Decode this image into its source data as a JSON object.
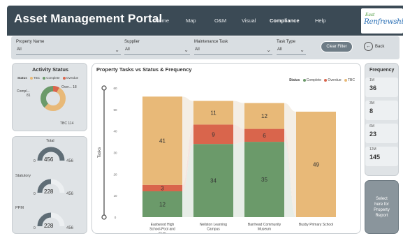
{
  "header": {
    "title": "Asset Management Portal",
    "nav": [
      "Home",
      "Map",
      "O&M",
      "Visual",
      "Compliance",
      "Help"
    ],
    "active_nav": "Compliance",
    "logo_top": "East",
    "logo_main": "Renfrewshire"
  },
  "filters": {
    "items": [
      {
        "label": "Property Name",
        "value": "All"
      },
      {
        "label": "Supplier",
        "value": "All"
      },
      {
        "label": "Maintenance Task",
        "value": "All"
      },
      {
        "label": "Task Type",
        "value": "All"
      }
    ],
    "clear_label": "Clear Filter",
    "back_label": "Back"
  },
  "activity": {
    "title": "Activity Status",
    "legend_prefix": "Status",
    "legend": [
      {
        "name": "TBC",
        "color": "#e8b978"
      },
      {
        "name": "Complete",
        "color": "#6b9a6a"
      },
      {
        "name": "Overdue",
        "color": "#d9654c"
      }
    ],
    "donut": [
      {
        "name": "Compl...",
        "value": 81,
        "color": "#6b9a6a"
      },
      {
        "name": "Over...",
        "value": 18,
        "color": "#d9654c"
      },
      {
        "name": "TBC",
        "value": 114,
        "color": "#e8b978"
      }
    ],
    "label_complete": "Compl...",
    "label_complete_val": "81",
    "label_overdue": "Over... 18",
    "label_tbc": "TBC 114"
  },
  "gauges": [
    {
      "label": "Total",
      "value": 456,
      "max": 456,
      "value_text": "456",
      "min_text": "0",
      "max_text": "456"
    },
    {
      "label": "Statutory",
      "value": 228,
      "max": 456,
      "value_text": "228",
      "min_text": "0",
      "max_text": "456"
    },
    {
      "label": "PPM",
      "value": 228,
      "max": 456,
      "value_text": "228",
      "min_text": "0",
      "max_text": "456"
    }
  ],
  "chart_data": {
    "type": "bar",
    "title": "Property Tasks vs Status & Frequency",
    "legend_title": "Status",
    "ylabel": "Tasks",
    "ylim": [
      0,
      60
    ],
    "yticks": [
      "0",
      "10",
      "20",
      "30",
      "40",
      "50",
      "60"
    ],
    "categories": [
      "Eastwood High School-Pool and Gym",
      "Neilston Learning Campus",
      "Barrhead Community Museum",
      "Busby Primary School"
    ],
    "series": [
      {
        "name": "Complete",
        "color": "#6b9a6a",
        "values": [
          12,
          34,
          35,
          0
        ]
      },
      {
        "name": "Overdue",
        "color": "#d9654c",
        "values": [
          3,
          9,
          6,
          0
        ]
      },
      {
        "name": "TBC",
        "color": "#e8b978",
        "values": [
          41,
          11,
          12,
          49
        ]
      }
    ],
    "grid": false,
    "legend_position": "top-right"
  },
  "frequency": {
    "title": "Frequency",
    "items": [
      {
        "label": "1M",
        "value": "36"
      },
      {
        "label": "3M",
        "value": "8"
      },
      {
        "label": "6M",
        "value": "23"
      },
      {
        "label": "12M",
        "value": "145"
      }
    ]
  },
  "report_button": {
    "lines": [
      "Select",
      "here for",
      "Property",
      "Report"
    ]
  },
  "colors": {
    "header": "#3b4a55",
    "complete": "#6b9a6a",
    "overdue": "#d9654c",
    "tbc": "#e8b978"
  }
}
